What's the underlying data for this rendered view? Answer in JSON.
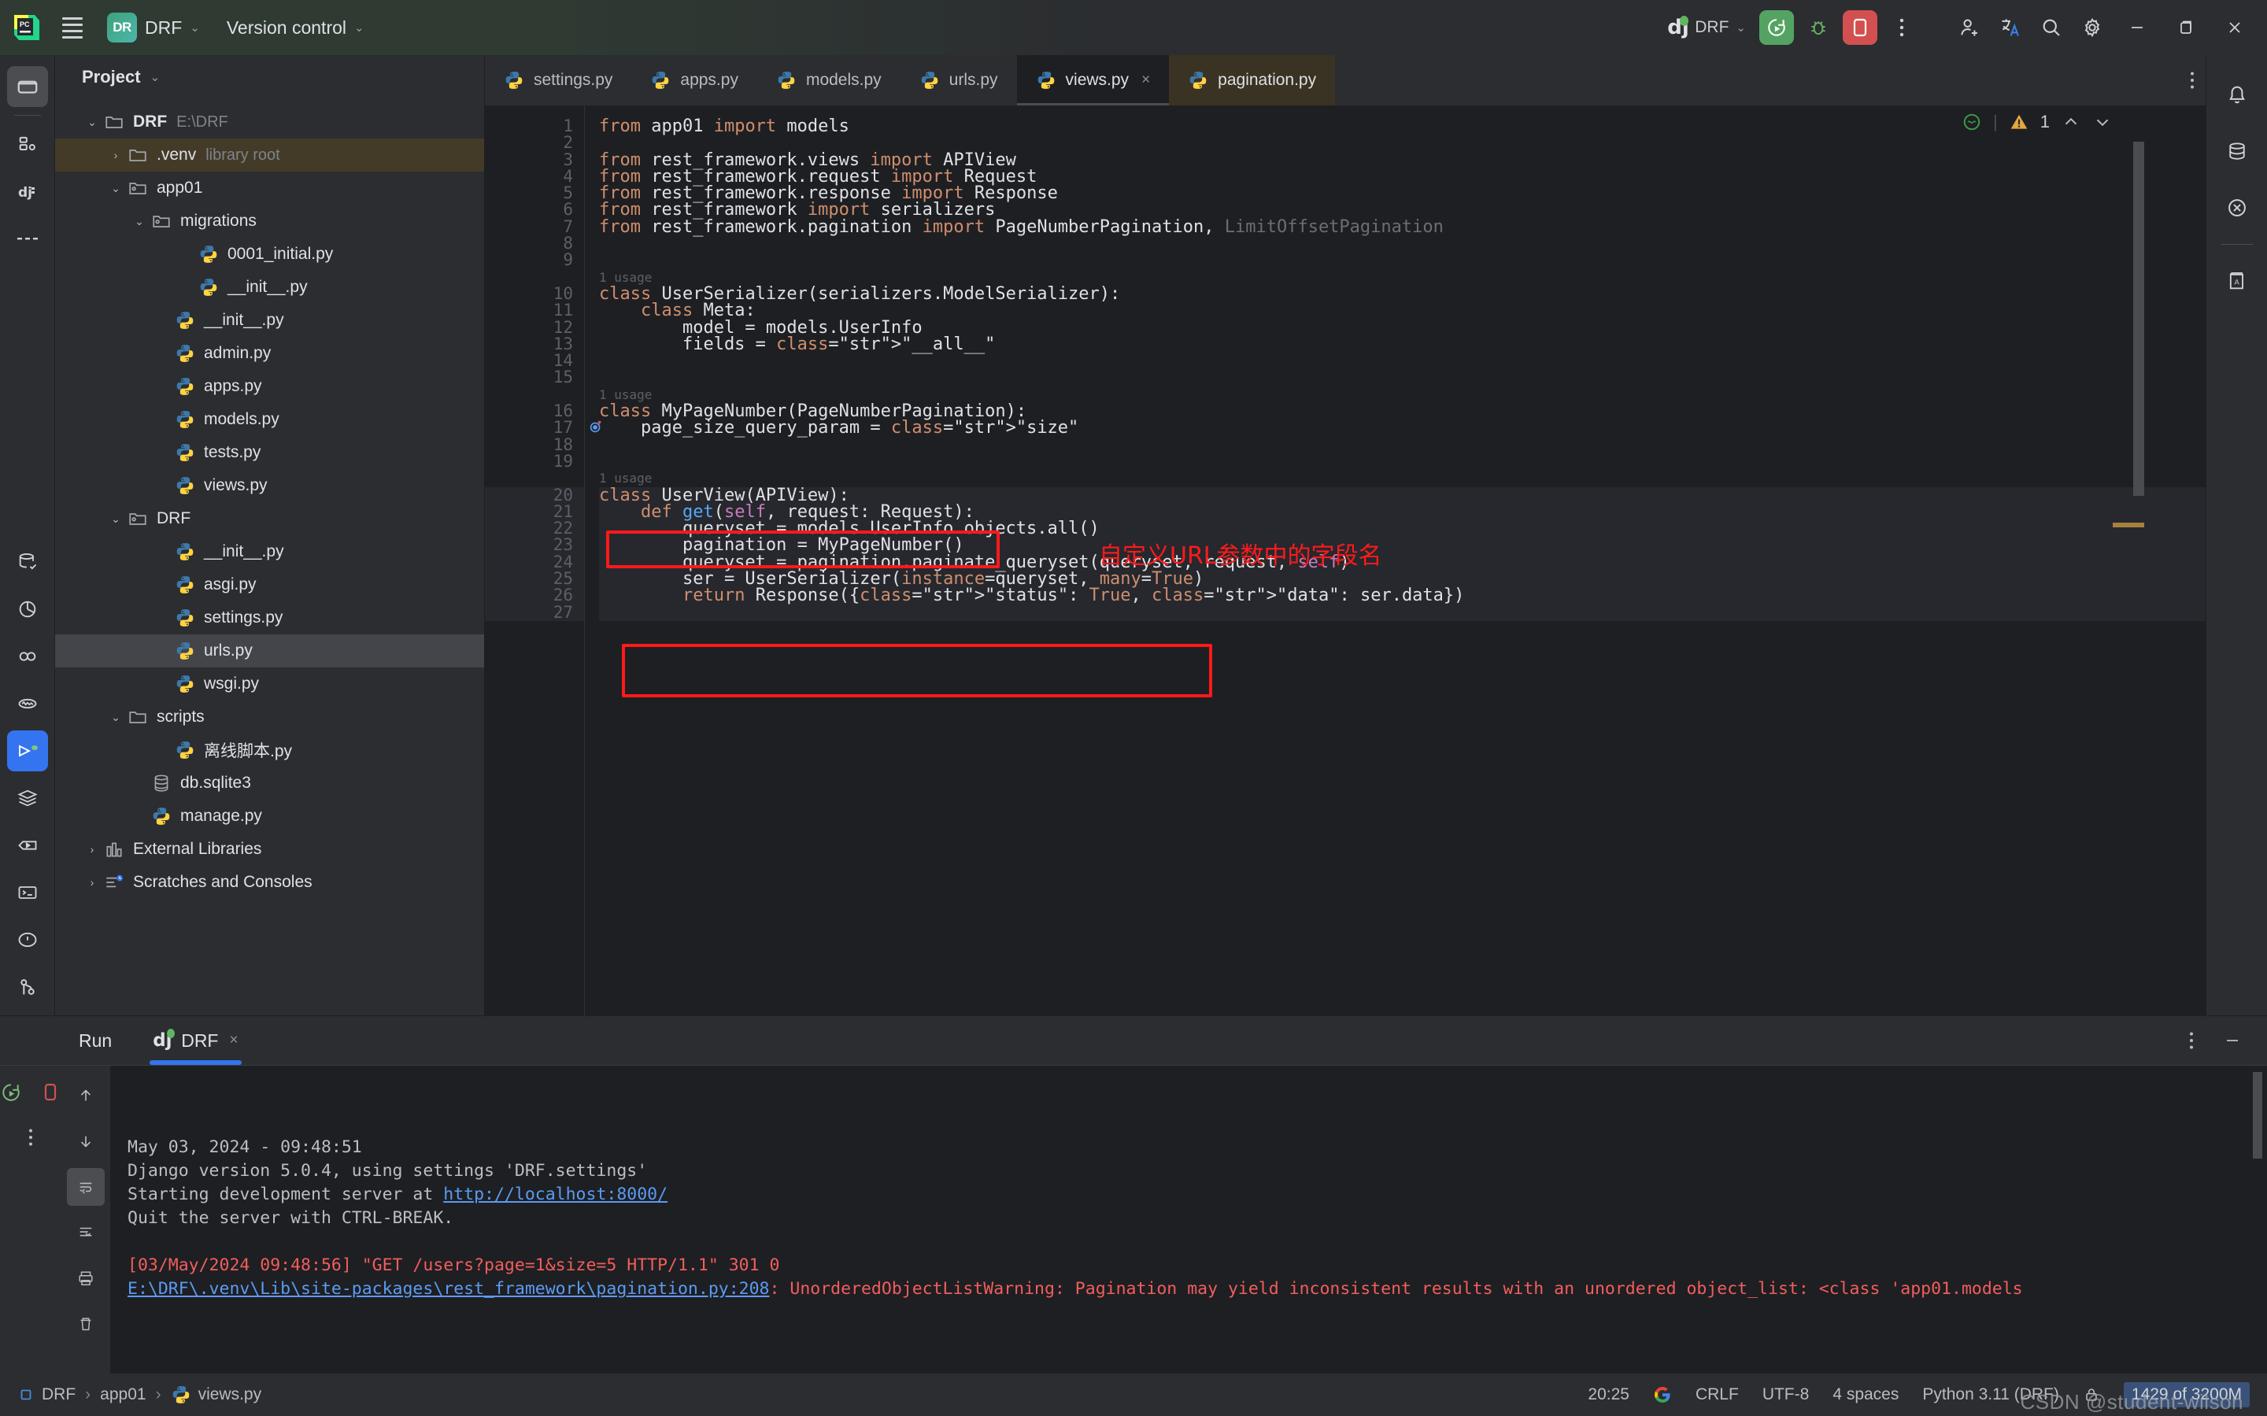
{
  "titlebar": {
    "menu_icon": "hamburger-icon",
    "project_badge": "DR",
    "project_name": "DRF",
    "version_control": "Version control",
    "run_config_name": "DRF",
    "run_icon": "run-icon",
    "debug_icon": "debug-icon",
    "stop_icon": "stop-icon",
    "more_icon": "more-vertical-icon",
    "add_user_icon": "add-user-icon",
    "translate_icon": "translate-icon",
    "search_icon": "search-icon",
    "settings_icon": "gear-icon",
    "minimize_icon": "minimize-icon",
    "maximize_icon": "maximize-icon",
    "close_icon": "close-icon"
  },
  "left_rail": {
    "items": [
      {
        "name": "project-icon",
        "active": true
      },
      {
        "name": "commit-icon",
        "active": false
      },
      {
        "name": "django-icon",
        "active": false
      },
      {
        "name": "more-tool-windows-icon",
        "active": false
      }
    ],
    "bottom_items": [
      {
        "name": "database-icon"
      },
      {
        "name": "profiler-icon"
      },
      {
        "name": "python-packages-icon"
      },
      {
        "name": "endpoints-icon"
      },
      {
        "name": "run-tool-icon",
        "active": true
      },
      {
        "name": "services-icon"
      },
      {
        "name": "python-console-icon"
      },
      {
        "name": "terminal-icon"
      },
      {
        "name": "problems-icon"
      },
      {
        "name": "version-control-icon"
      }
    ]
  },
  "panel": {
    "title": "Project",
    "chevron": "chevron-down-icon",
    "tree": [
      {
        "indent": 0,
        "arrow": "v",
        "icon": "folder",
        "label": "DRF",
        "bold": true,
        "hint": "E:\\DRF",
        "state": "normal"
      },
      {
        "indent": 1,
        "arrow": ">",
        "icon": "folder",
        "label": ".venv",
        "hint": "library root",
        "state": "venv"
      },
      {
        "indent": 1,
        "arrow": "v",
        "icon": "module-folder",
        "label": "app01",
        "hint": "",
        "state": "normal"
      },
      {
        "indent": 2,
        "arrow": "v",
        "icon": "module-folder",
        "label": "migrations",
        "hint": "",
        "state": "normal"
      },
      {
        "indent": 4,
        "arrow": "",
        "icon": "python",
        "label": "0001_initial.py",
        "hint": "",
        "state": "normal"
      },
      {
        "indent": 4,
        "arrow": "",
        "icon": "python",
        "label": "__init__.py",
        "hint": "",
        "state": "normal"
      },
      {
        "indent": 3,
        "arrow": "",
        "icon": "python",
        "label": "__init__.py",
        "hint": "",
        "state": "normal"
      },
      {
        "indent": 3,
        "arrow": "",
        "icon": "python",
        "label": "admin.py",
        "hint": "",
        "state": "normal"
      },
      {
        "indent": 3,
        "arrow": "",
        "icon": "python",
        "label": "apps.py",
        "hint": "",
        "state": "normal"
      },
      {
        "indent": 3,
        "arrow": "",
        "icon": "python",
        "label": "models.py",
        "hint": "",
        "state": "normal"
      },
      {
        "indent": 3,
        "arrow": "",
        "icon": "python",
        "label": "tests.py",
        "hint": "",
        "state": "normal"
      },
      {
        "indent": 3,
        "arrow": "",
        "icon": "python",
        "label": "views.py",
        "hint": "",
        "state": "normal"
      },
      {
        "indent": 1,
        "arrow": "v",
        "icon": "module-folder",
        "label": "DRF",
        "hint": "",
        "state": "normal"
      },
      {
        "indent": 3,
        "arrow": "",
        "icon": "python",
        "label": "__init__.py",
        "hint": "",
        "state": "normal"
      },
      {
        "indent": 3,
        "arrow": "",
        "icon": "python",
        "label": "asgi.py",
        "hint": "",
        "state": "normal"
      },
      {
        "indent": 3,
        "arrow": "",
        "icon": "python",
        "label": "settings.py",
        "hint": "",
        "state": "normal"
      },
      {
        "indent": 3,
        "arrow": "",
        "icon": "python",
        "label": "urls.py",
        "hint": "",
        "state": "selected"
      },
      {
        "indent": 3,
        "arrow": "",
        "icon": "python",
        "label": "wsgi.py",
        "hint": "",
        "state": "normal"
      },
      {
        "indent": 1,
        "arrow": "v",
        "icon": "folder",
        "label": "scripts",
        "hint": "",
        "state": "normal"
      },
      {
        "indent": 3,
        "arrow": "",
        "icon": "python",
        "label": "离线脚本.py",
        "hint": "",
        "state": "normal"
      },
      {
        "indent": 2,
        "arrow": "",
        "icon": "sqlite",
        "label": "db.sqlite3",
        "hint": "",
        "state": "normal"
      },
      {
        "indent": 2,
        "arrow": "",
        "icon": "python",
        "label": "manage.py",
        "hint": "",
        "state": "normal"
      },
      {
        "indent": 0,
        "arrow": ">",
        "icon": "library",
        "label": "External Libraries",
        "hint": "",
        "state": "normal"
      },
      {
        "indent": 0,
        "arrow": ">",
        "icon": "scratches",
        "label": "Scratches and Consoles",
        "hint": "",
        "state": "normal"
      }
    ]
  },
  "editor": {
    "tabs": [
      {
        "label": "settings.py",
        "icon": "python-file-icon",
        "state": "normal"
      },
      {
        "label": "apps.py",
        "icon": "python-file-icon",
        "state": "normal"
      },
      {
        "label": "models.py",
        "icon": "python-file-icon",
        "state": "normal"
      },
      {
        "label": "urls.py",
        "icon": "python-file-icon",
        "state": "normal"
      },
      {
        "label": "views.py",
        "icon": "python-file-icon",
        "state": "active",
        "closable": true
      },
      {
        "label": "pagination.py",
        "icon": "python-file-icon",
        "state": "pinned"
      }
    ],
    "tab_close_glyph": "×",
    "tabbar_more_icon": "more-vertical-icon",
    "inspections": {
      "ok_icon": "inspection-ok-icon",
      "warning_icon": "warning-triangle-icon",
      "warning_count": "1",
      "prev_icon": "chevron-up-icon",
      "next_icon": "chevron-down-icon"
    },
    "usage_label": "1 usage",
    "gutter_marker_icon": "override-method-icon",
    "line_numbers": [
      "1",
      "2",
      "3",
      "4",
      "5",
      "6",
      "7",
      "8",
      "9",
      "10",
      "11",
      "12",
      "13",
      "14",
      "15",
      "16",
      "17",
      "18",
      "19",
      "20",
      "21",
      "22",
      "23",
      "24",
      "25",
      "26",
      "27"
    ],
    "code_lines": [
      "from app01 import models",
      "",
      "from rest_framework.views import APIView",
      "from rest_framework.request import Request",
      "from rest_framework.response import Response",
      "from rest_framework import serializers",
      "from rest_framework.pagination import PageNumberPagination, LimitOffsetPagination",
      "",
      "",
      "class UserSerializer(serializers.ModelSerializer):",
      "    class Meta:",
      "        model = models.UserInfo",
      "        fields = \"__all__\"",
      "",
      "",
      "class MyPageNumber(PageNumberPagination):",
      "    page_size_query_param = \"size\"",
      "",
      "",
      "class UserView(APIView):",
      "    def get(self, request: Request):",
      "        queryset = models.UserInfo.objects.all()",
      "        pagination = MyPageNumber()",
      "        queryset = pagination.paginate_queryset(queryset, request, self)",
      "        ser = UserSerializer(instance=queryset, many=True)",
      "        return Response({\"status\": True, \"data\": ser.data})",
      ""
    ],
    "annotation_note": "自定义URL参数中的字段名"
  },
  "right_rail": {
    "items": [
      {
        "name": "database-icon"
      },
      {
        "name": "xpath-icon"
      },
      {
        "name": "notifications-icon"
      },
      {
        "name": "ai-assistant-icon"
      },
      {
        "name": "dictionary-icon"
      }
    ]
  },
  "run_panel": {
    "tabs": [
      {
        "label": "Run",
        "icon": "",
        "active": false
      },
      {
        "label": "DRF",
        "icon": "django-icon",
        "active": true,
        "closable": true
      }
    ],
    "close_glyph": "×",
    "toolbar": [
      {
        "name": "rerun-icon"
      },
      {
        "name": "stop-icon"
      },
      {
        "name": "more-vertical-icon"
      }
    ],
    "side_buttons": [
      {
        "name": "scroll-up-icon"
      },
      {
        "name": "scroll-down-icon"
      },
      {
        "name": "soft-wrap-icon"
      },
      {
        "name": "scroll-to-end-icon"
      },
      {
        "name": "print-icon"
      },
      {
        "name": "clear-all-icon"
      }
    ],
    "options_icon": "more-vertical-icon",
    "minimize_icon": "minimize-icon",
    "console": [
      {
        "text": "May 03, 2024 - 09:48:51",
        "style": "normal"
      },
      {
        "text": "Django version 5.0.4, using settings 'DRF.settings'",
        "style": "normal"
      },
      {
        "text": "Starting development server at ",
        "style": "normal",
        "link": "http://localhost:8000/"
      },
      {
        "text": "Quit the server with CTRL-BREAK.",
        "style": "normal"
      },
      {
        "text": "",
        "style": "normal"
      },
      {
        "text": "[03/May/2024 09:48:56] \"GET /users?page=1&size=5 HTTP/1.1\" 301 0",
        "style": "error"
      },
      {
        "text": ": UnorderedObjectListWarning: Pagination may yield inconsistent results with an unordered object_list: <class 'app01.models",
        "style": "error",
        "link_prefix": "E:\\DRF\\.venv\\Lib\\site-packages\\rest_framework\\pagination.py:208"
      }
    ]
  },
  "statusbar": {
    "breadcrumbs": [
      {
        "label": "DRF",
        "icon": "project-square-icon"
      },
      {
        "label": "app01",
        "icon": ""
      },
      {
        "label": "views.py",
        "icon": "python-file-icon"
      }
    ],
    "separator": "›",
    "caret_position": "20:25",
    "google_icon": "google-icon",
    "line_separator": "CRLF",
    "encoding": "UTF-8",
    "indent": "4 spaces",
    "interpreter": "Python 3.11 (DRF)",
    "lock_icon": "lock-icon",
    "memory": "1429 of 3200M",
    "watermark": "CSDN @student-wilson"
  },
  "colors": {
    "accent_blue": "#3574f0",
    "run_green": "#55a362",
    "stop_red": "#d2504f",
    "annotation_red": "#ff1a1a",
    "warning_yellow": "#e3a53e",
    "editor_bg": "#1e1f22",
    "panel_bg": "#2b2d30"
  }
}
